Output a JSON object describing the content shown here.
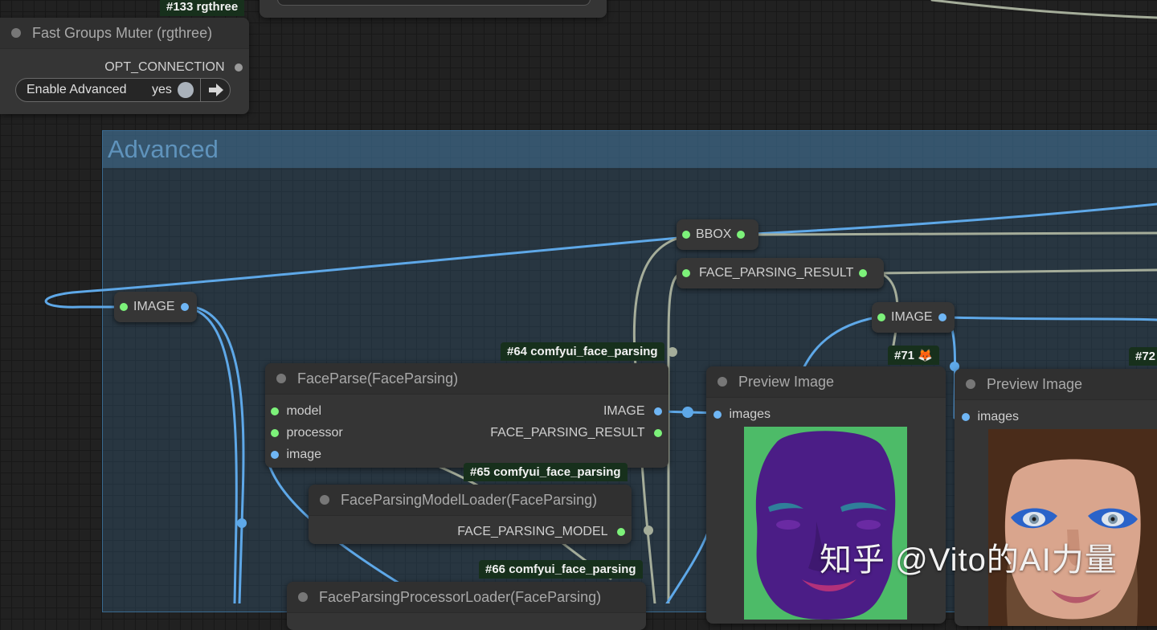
{
  "group": {
    "title": "Advanced"
  },
  "badges": {
    "rgthree": "#133 rgthree",
    "fp64": "#64 comfyui_face_parsing",
    "fp65": "#65 comfyui_face_parsing",
    "fp66": "#66 comfyui_face_parsing",
    "n71": "#71 🦊",
    "n72": "#72"
  },
  "muter": {
    "title": "Fast Groups Muter (rgthree)",
    "output": "OPT_CONNECTION",
    "toggle_label": "Enable Advanced",
    "toggle_value": "yes"
  },
  "reroutes": {
    "image_left": "IMAGE",
    "bbox": "BBOX",
    "face_parsing_result": "FACE_PARSING_RESULT",
    "image_right": "IMAGE"
  },
  "faceparse": {
    "title": "FaceParse(FaceParsing)",
    "inputs": [
      "model",
      "processor",
      "image"
    ],
    "outputs": [
      "IMAGE",
      "FACE_PARSING_RESULT"
    ]
  },
  "model_loader": {
    "title": "FaceParsingModelLoader(FaceParsing)",
    "output": "FACE_PARSING_MODEL"
  },
  "processor_loader": {
    "title": "FaceParsingProcessorLoader(FaceParsing)"
  },
  "preview1": {
    "title": "Preview Image",
    "input": "images"
  },
  "preview2": {
    "title": "Preview Image",
    "input": "images"
  },
  "watermark": "知乎 @Vito的AI力量",
  "colors": {
    "canvas": "#212121",
    "node": "#353535",
    "image_slot": "#6fb6f5",
    "data_slot": "#7df27a",
    "wire_image": "#5ea8e8",
    "wire_data": "#a5ad9a",
    "group": "#3a6a8f"
  }
}
